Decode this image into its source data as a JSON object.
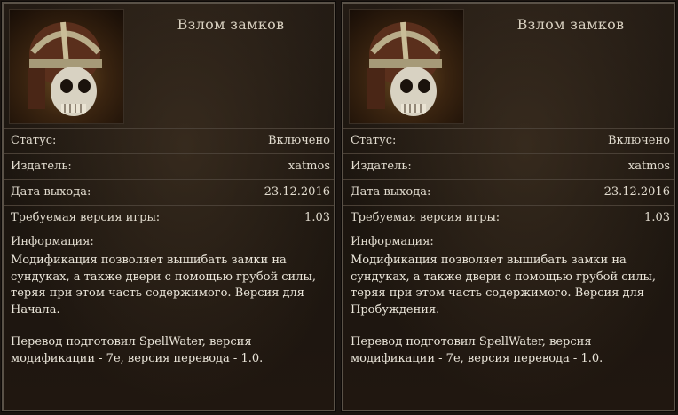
{
  "panels": [
    {
      "title": "Взлом замков",
      "icon": "skull-helmet-icon",
      "rows": [
        {
          "label": "Статус:",
          "value": "Включено"
        },
        {
          "label": "Издатель:",
          "value": "xatmos"
        },
        {
          "label": "Дата выхода:",
          "value": "23.12.2016"
        },
        {
          "label": "Требуемая версия игры:",
          "value": "1.03"
        }
      ],
      "info_label": "Информация:",
      "description": "Модификация позволяет вышибать замки на сундуках, а также двери с помощью грубой силы, теряя при этом часть содержимого. Версия для Начала.",
      "translation_note": "Перевод подготовил SpellWater, версия модификации - 7е, версия перевода - 1.0."
    },
    {
      "title": "Взлом замков",
      "icon": "skull-helmet-icon",
      "rows": [
        {
          "label": "Статус:",
          "value": "Включено"
        },
        {
          "label": "Издатель:",
          "value": "xatmos"
        },
        {
          "label": "Дата выхода:",
          "value": "23.12.2016"
        },
        {
          "label": "Требуемая версия игры:",
          "value": "1.03"
        }
      ],
      "info_label": "Информация:",
      "description": "Модификация позволяет вышибать замки на сундуках, а также двери с помощью грубой силы, теряя при этом часть содержимого. Версия для Пробуждения.",
      "translation_note": "Перевод подготовил SpellWater, версия модификации - 7е, версия перевода - 1.0."
    }
  ]
}
